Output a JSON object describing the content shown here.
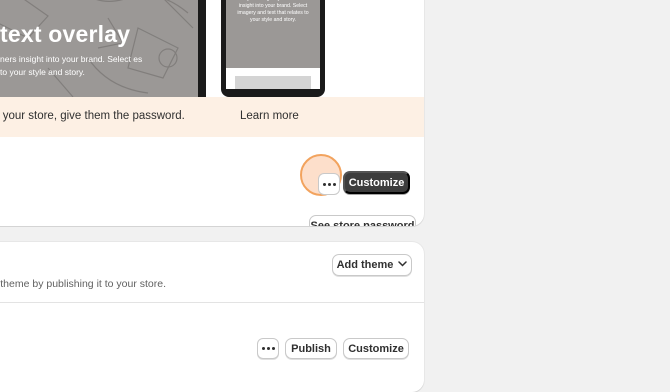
{
  "preview": {
    "desktop_title": "text overlay",
    "desktop_subtitle": "ners insight into your brand. Select es to your style and story.",
    "mobile_text": "overlay text to give your customers insight into your brand. Select imagery and text that relates to your style and story."
  },
  "banner": {
    "text": "ss your store, give them the password.",
    "learn_more": "Learn more",
    "store_password_button": "See store password"
  },
  "current_theme": {
    "customize_label": "Customize"
  },
  "theme_library": {
    "add_theme_label": "Add theme",
    "description": "er theme by publishing it to your store.",
    "publish_label": "Publish",
    "customize_label": "Customize"
  },
  "colors": {
    "banner_bg": "#fdf0e4",
    "highlight": "#f2a35e",
    "primary_button": "#3d3d3d"
  },
  "icons": {
    "more_actions": "more-dots-icon",
    "chevron": "chevron-down-icon"
  }
}
